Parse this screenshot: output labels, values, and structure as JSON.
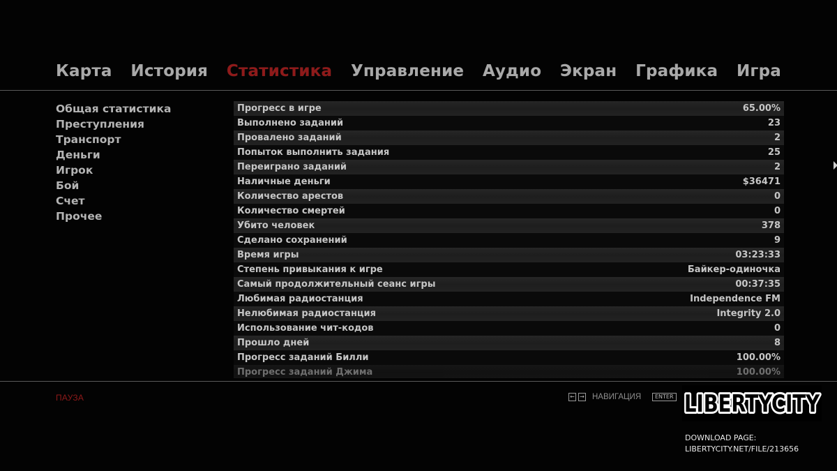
{
  "tabs": [
    {
      "label": "Карта",
      "active": false
    },
    {
      "label": "История",
      "active": false
    },
    {
      "label": "Статистика",
      "active": true
    },
    {
      "label": "Управление",
      "active": false
    },
    {
      "label": "Аудио",
      "active": false
    },
    {
      "label": "Экран",
      "active": false
    },
    {
      "label": "Графика",
      "active": false
    },
    {
      "label": "Игра",
      "active": false
    }
  ],
  "categories": [
    "Общая статистика",
    "Преступления",
    "Транспорт",
    "Деньги",
    "Игрок",
    "Бой",
    "Счет",
    "Прочее"
  ],
  "stats": [
    {
      "label": "Прогресс в игре",
      "value": "65.00%"
    },
    {
      "label": "Выполнено заданий",
      "value": "23"
    },
    {
      "label": "Провалено заданий",
      "value": "2"
    },
    {
      "label": "Попыток выполнить задания",
      "value": "25"
    },
    {
      "label": "Переиграно заданий",
      "value": "2"
    },
    {
      "label": "Наличные деньги",
      "value": "$36471"
    },
    {
      "label": "Количество арестов",
      "value": "0"
    },
    {
      "label": "Количество смертей",
      "value": "0"
    },
    {
      "label": "Убито человек",
      "value": "378"
    },
    {
      "label": "Сделано сохранений",
      "value": "9"
    },
    {
      "label": "Время игры",
      "value": "03:23:33"
    },
    {
      "label": "Степень привыкания к игре",
      "value": "Байкер-одиночка"
    },
    {
      "label": "Самый продолжительный сеанс игры",
      "value": "00:37:35"
    },
    {
      "label": "Любимая радиостанция",
      "value": "Independence FM"
    },
    {
      "label": "Нелюбимая радиостанция",
      "value": "Integrity 2.0"
    },
    {
      "label": "Использование чит-кодов",
      "value": "0"
    },
    {
      "label": "Прошло дней",
      "value": "8"
    },
    {
      "label": "Прогресс заданий Билли",
      "value": "100.00%"
    },
    {
      "label": "Прогресс заданий Джима",
      "value": "100.00%"
    }
  ],
  "footer": {
    "pause": "ПАУЗА",
    "nav_left_key": "←",
    "nav_right_key": "→",
    "nav_label": "НАВИГАЦИЯ",
    "enter_key": "ENTER"
  },
  "watermark": {
    "logo_text": "LIBERTYCITY",
    "download_line1": "DOWNLOAD PAGE:",
    "download_line2": "LIBERTYCITY.NET/FILE/213656"
  },
  "colors": {
    "active_tab": "#8f1a1a",
    "inactive_tab": "#a9a9a9",
    "text": "#c6c6c6",
    "background": "#030303"
  },
  "icons": {
    "nav_left": "arrow-left-icon",
    "nav_right": "arrow-right-icon",
    "side": "scroll-right-arrow-icon"
  }
}
